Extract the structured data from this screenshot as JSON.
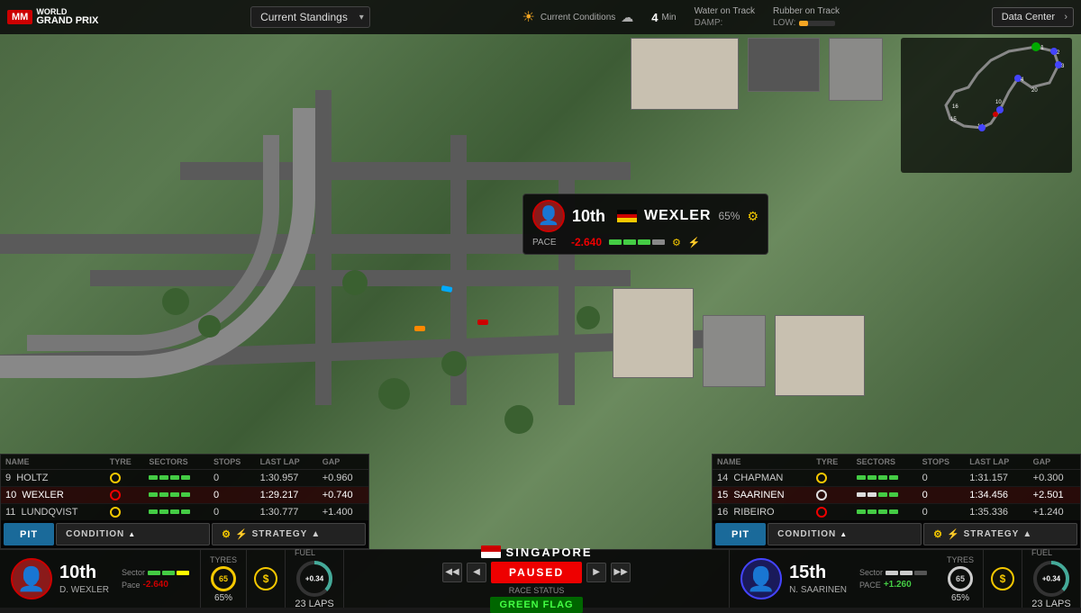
{
  "app": {
    "title": "Motorsport Manager World Grand Prix"
  },
  "header": {
    "mm_label": "MM",
    "wgp_world": "WORLD",
    "wgp_gp": "GRAND PRIX",
    "standings_label": "Current Standings",
    "weather_label": "Current Conditions",
    "timer_value": "4",
    "timer_unit": "Min",
    "water_label": "Water on Track",
    "damp_label": "DAMP:",
    "rubber_label": "Rubber on Track",
    "rubber_level": "LOW:",
    "data_center": "Data Center"
  },
  "driver_bubble": {
    "position": "10th",
    "name": "WEXLER",
    "percentage": "65%",
    "pace_label": "PACE",
    "pace_value": "-2.640",
    "flag": "DE"
  },
  "left_standings": {
    "headers": [
      "Name",
      "Tyre",
      "Sectors",
      "Stops",
      "Last Lap",
      "Gap"
    ],
    "rows": [
      {
        "pos": "9",
        "name": "HOLTZ",
        "tyre": "gold",
        "sectors": [
          "g",
          "g",
          "g",
          "g"
        ],
        "stops": "0",
        "last_lap": "1:30.957",
        "gap": "+0.960"
      },
      {
        "pos": "10",
        "name": "WEXLER",
        "tyre": "red",
        "sectors": [
          "g",
          "g",
          "g",
          "g"
        ],
        "stops": "0",
        "last_lap": "1:29.217",
        "gap": "+0.740",
        "highlighted": true
      },
      {
        "pos": "11",
        "name": "LUNDQVIST",
        "tyre": "gold",
        "sectors": [
          "g",
          "g",
          "g",
          "g"
        ],
        "stops": "0",
        "last_lap": "1:30.777",
        "gap": "+1.400"
      }
    ],
    "pit_label": "PIT",
    "condition_label": "CONDITION",
    "strategy_label": "STRATEGY"
  },
  "right_standings": {
    "headers": [
      "Name",
      "Tyre",
      "Sectors",
      "Stops",
      "Last Lap",
      "Gap"
    ],
    "rows": [
      {
        "pos": "14",
        "name": "CHAPMAN",
        "tyre": "gold",
        "sectors": [
          "g",
          "g",
          "g",
          "g"
        ],
        "stops": "0",
        "last_lap": "1:31.157",
        "gap": "+0.300"
      },
      {
        "pos": "15",
        "name": "SAARINEN",
        "tyre": "white",
        "sectors": [
          "w",
          "w",
          "g",
          "g"
        ],
        "stops": "0",
        "last_lap": "1:34.456",
        "gap": "+2.501",
        "highlighted": true
      },
      {
        "pos": "16",
        "name": "RIBEIRO",
        "tyre": "red",
        "sectors": [
          "g",
          "g",
          "g",
          "g"
        ],
        "stops": "0",
        "last_lap": "1:35.336",
        "gap": "+1.240"
      }
    ],
    "pit_label": "PIT",
    "condition_label": "CONDITION",
    "strategy_label": "STRATEGY"
  },
  "status_bar_left": {
    "position": "10th",
    "position_suffix": "",
    "driver_name": "D. WEXLER",
    "sector_label": "Sector",
    "pace_label": "Pace",
    "pace_value": "-2.640",
    "tyres_label": "Tyres",
    "tyres_pct": "65%",
    "fuel_label": "Fuel",
    "fuel_val": "+0.34",
    "laps_label": "23 LAPS"
  },
  "status_bar_right": {
    "position": "15th",
    "driver_name": "N. SAARINEN",
    "sector_label": "Sector",
    "pace_label": "PACE",
    "pace_value": "+1.260",
    "tyres_label": "Tyres",
    "tyres_pct": "65%",
    "fuel_label": "Fuel",
    "fuel_val": "+0.34",
    "laps_label": "23 LAPS"
  },
  "center_status": {
    "location": "SINGAPORE",
    "paused_label": "PAUSED",
    "race_status_label": "Race Status",
    "green_flag_label": "GREEN FLAG"
  },
  "minimap": {
    "label": "Mini Map"
  }
}
